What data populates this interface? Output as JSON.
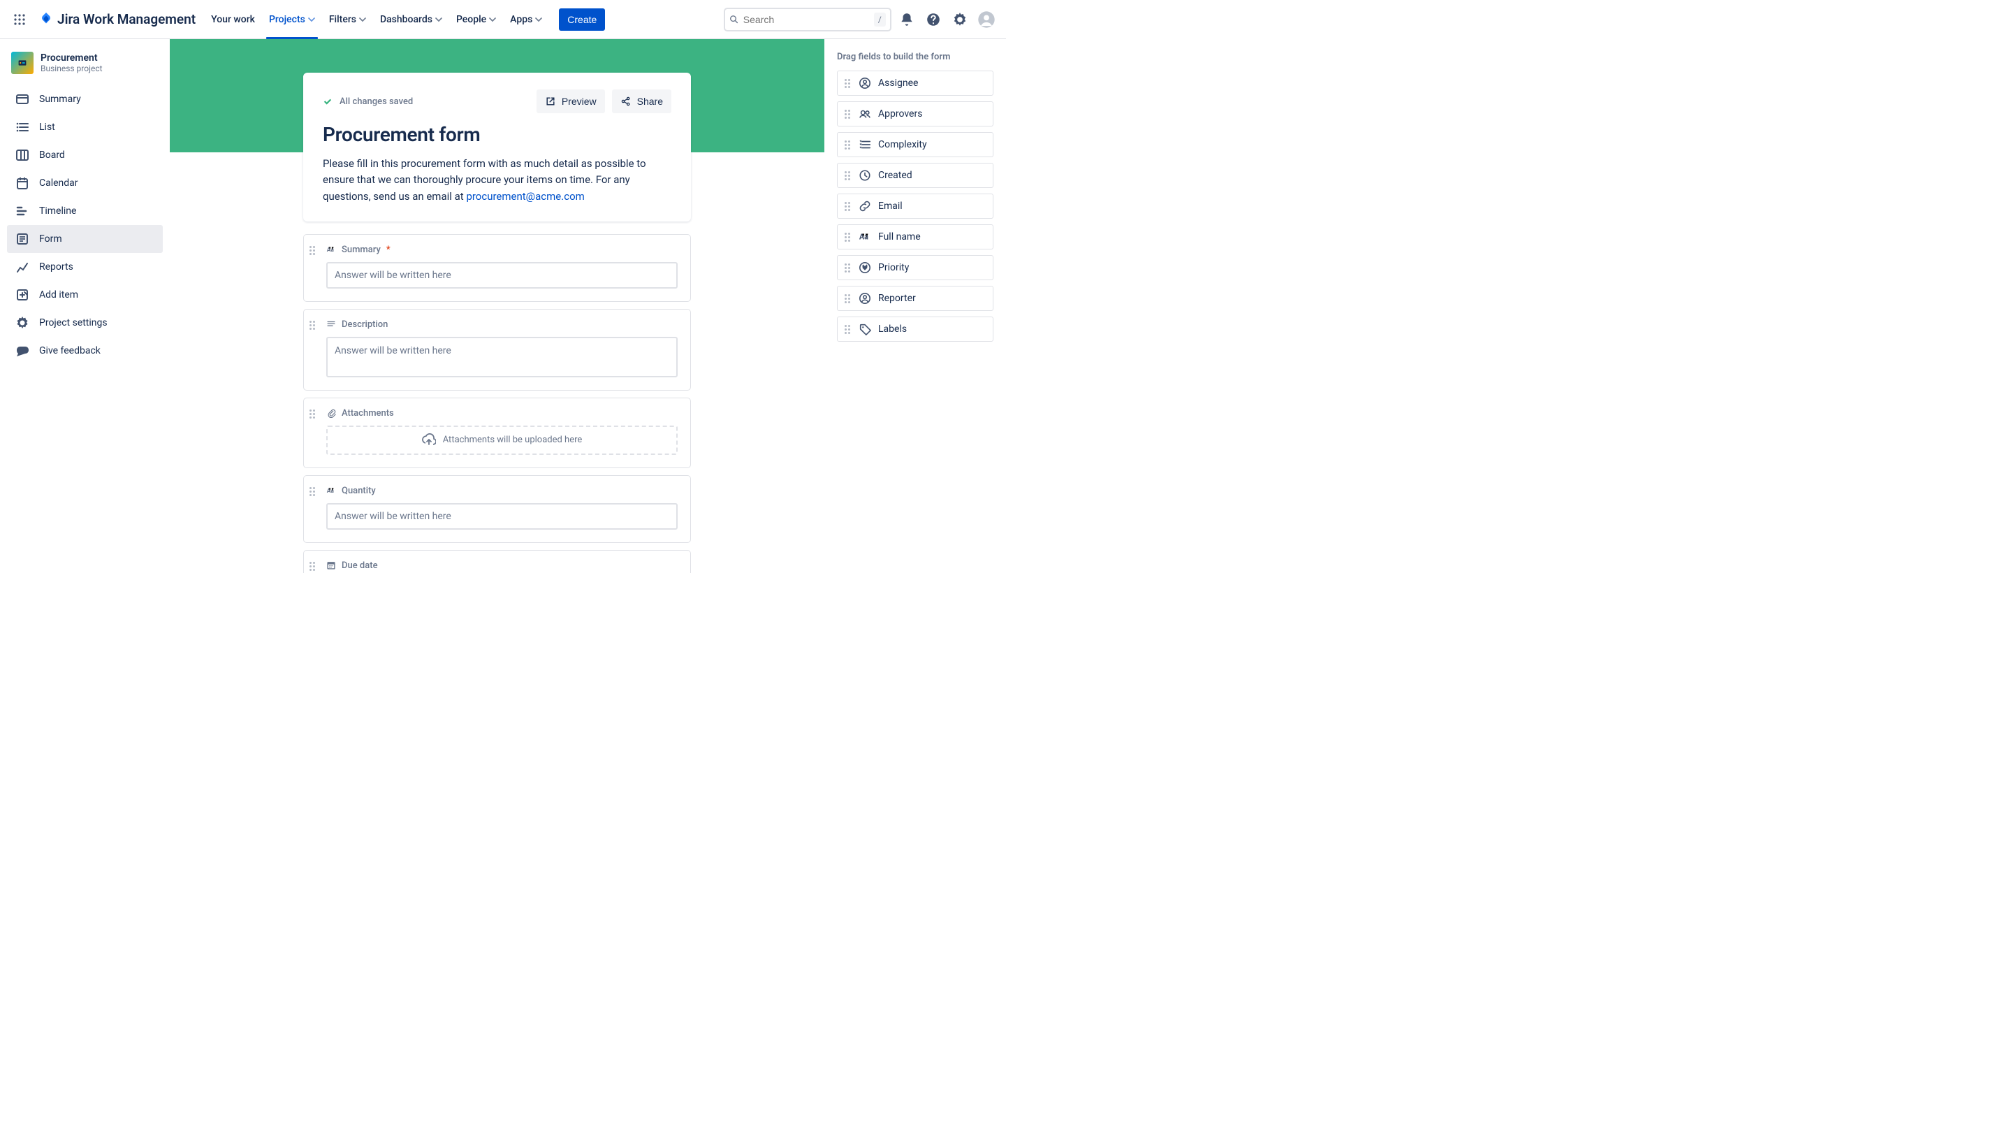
{
  "brand": "Jira Work Management",
  "nav": {
    "items": [
      {
        "label": "Your work",
        "dropdown": false
      },
      {
        "label": "Projects",
        "dropdown": true,
        "active": true
      },
      {
        "label": "Filters",
        "dropdown": true
      },
      {
        "label": "Dashboards",
        "dropdown": true
      },
      {
        "label": "People",
        "dropdown": true
      },
      {
        "label": "Apps",
        "dropdown": true
      }
    ],
    "create": "Create",
    "search_placeholder": "Search",
    "search_kbd": "/"
  },
  "project": {
    "name": "Procurement",
    "type": "Business project"
  },
  "sidebar": [
    {
      "icon": "card",
      "label": "Summary"
    },
    {
      "icon": "list",
      "label": "List"
    },
    {
      "icon": "board",
      "label": "Board"
    },
    {
      "icon": "calendar",
      "label": "Calendar"
    },
    {
      "icon": "timeline",
      "label": "Timeline"
    },
    {
      "icon": "form",
      "label": "Form",
      "active": true
    },
    {
      "icon": "reports",
      "label": "Reports"
    },
    {
      "icon": "add",
      "label": "Add item"
    },
    {
      "icon": "gear",
      "label": "Project settings"
    },
    {
      "icon": "feedback",
      "label": "Give feedback"
    }
  ],
  "form": {
    "saved": "All changes saved",
    "preview": "Preview",
    "share": "Share",
    "title": "Procurement form",
    "desc_pre": "Please fill in this procurement form with as much detail as possible to ensure that we can thoroughly procure your items on time. For any questions, send us an email at ",
    "desc_link": "procurement@acme.com",
    "placeholder": "Answer will be written here",
    "attach_placeholder": "Attachments will be uploaded here",
    "fields": [
      {
        "icon": "text",
        "label": "Summary",
        "required": true,
        "kind": "text"
      },
      {
        "icon": "para",
        "label": "Description",
        "kind": "textarea"
      },
      {
        "icon": "attach",
        "label": "Attachments",
        "kind": "attach"
      },
      {
        "icon": "text",
        "label": "Quantity",
        "kind": "text"
      },
      {
        "icon": "date",
        "label": "Due date",
        "kind": "date"
      }
    ]
  },
  "panel": {
    "title": "Drag fields to build the form",
    "fields": [
      {
        "icon": "person",
        "label": "Assignee"
      },
      {
        "icon": "people",
        "label": "Approvers"
      },
      {
        "icon": "listnum",
        "label": "Complexity"
      },
      {
        "icon": "clock",
        "label": "Created"
      },
      {
        "icon": "link",
        "label": "Email"
      },
      {
        "icon": "text",
        "label": "Full name"
      },
      {
        "icon": "priority",
        "label": "Priority"
      },
      {
        "icon": "person",
        "label": "Reporter"
      },
      {
        "icon": "tag",
        "label": "Labels"
      }
    ]
  }
}
